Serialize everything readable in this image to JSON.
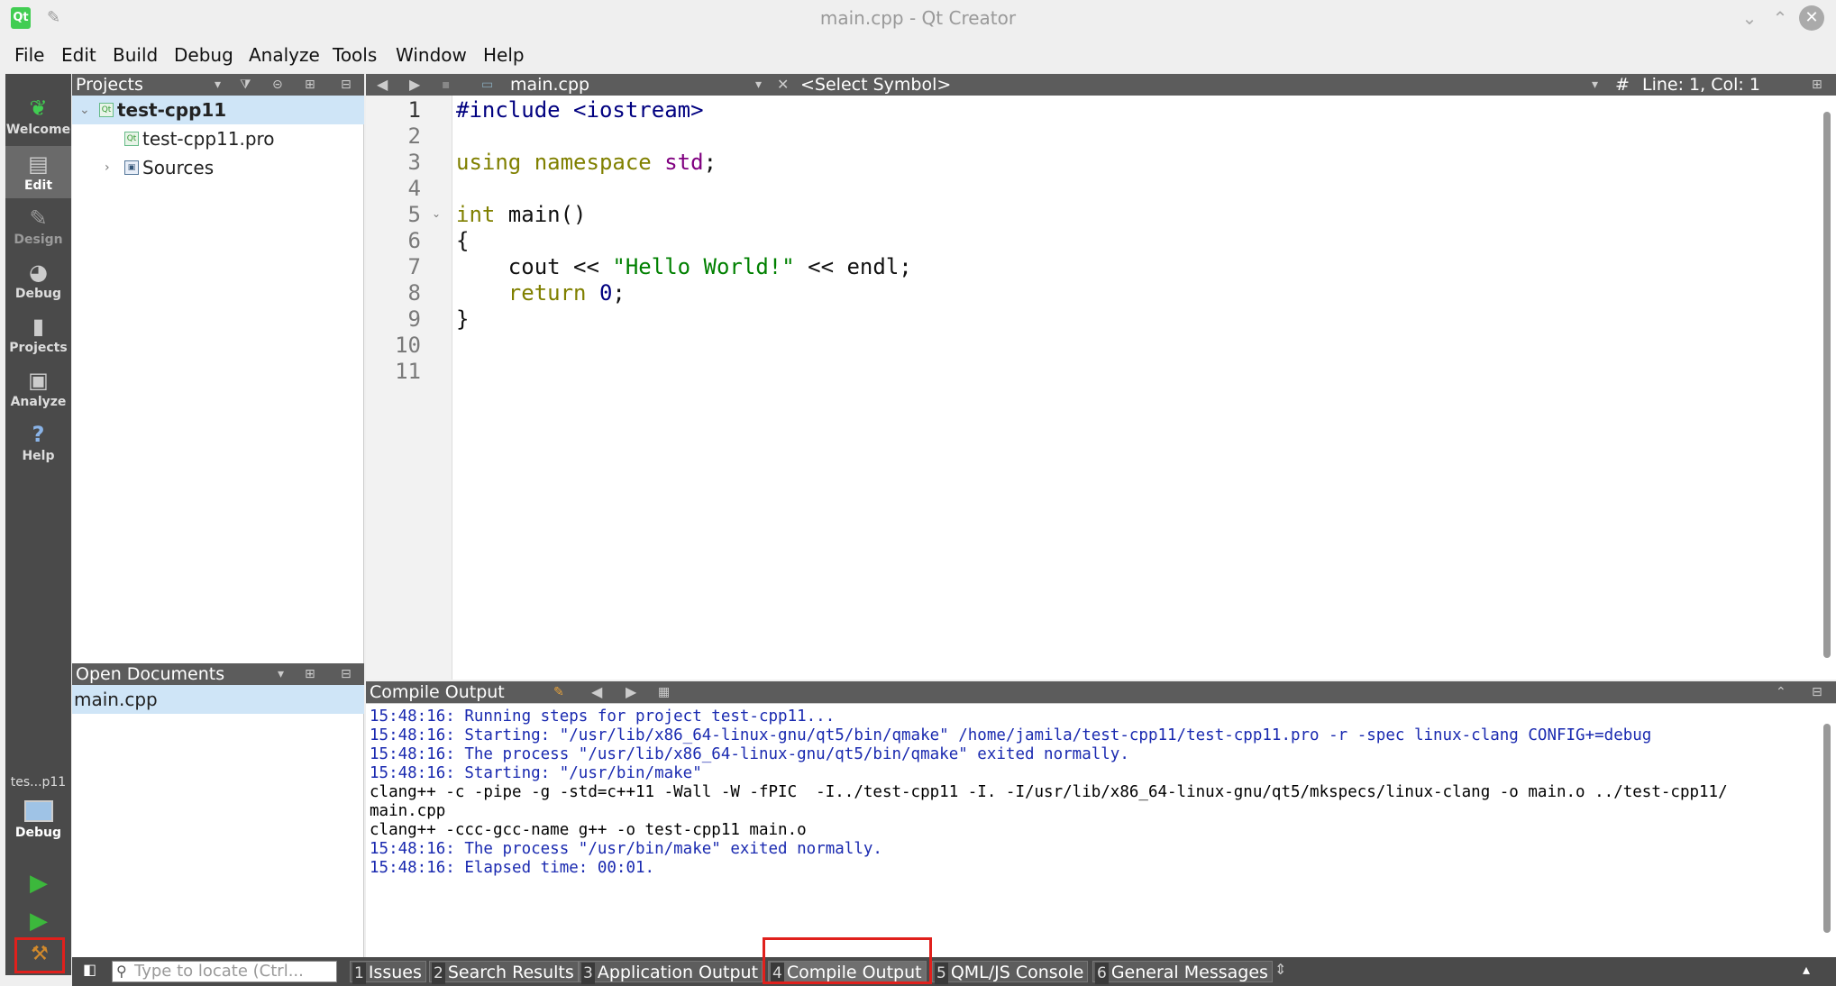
{
  "window": {
    "title": "main.cpp - Qt Creator",
    "logo_text": "Qt"
  },
  "menu": [
    "File",
    "Edit",
    "Build",
    "Debug",
    "Analyze",
    "Tools",
    "Window",
    "Help"
  ],
  "modes": [
    {
      "label": "Welcome",
      "icon": "qt-leaf-icon"
    },
    {
      "label": "Edit",
      "icon": "document-icon"
    },
    {
      "label": "Design",
      "icon": "pen-icon"
    },
    {
      "label": "Debug",
      "icon": "bug-icon"
    },
    {
      "label": "Projects",
      "icon": "wrench-icon"
    },
    {
      "label": "Analyze",
      "icon": "monitor-icon"
    },
    {
      "label": "Help",
      "icon": "question-icon"
    }
  ],
  "kit": {
    "project_short": "tes...p11",
    "build_config": "Debug"
  },
  "projects_panel": {
    "title": "Projects",
    "tree": [
      {
        "label": "test-cpp11",
        "level": 0,
        "expanded": true,
        "selected": true
      },
      {
        "label": "test-cpp11.pro",
        "level": 1
      },
      {
        "label": "Sources",
        "level": 1,
        "expanded": false
      }
    ]
  },
  "open_documents": {
    "title": "Open Documents",
    "items": [
      "main.cpp"
    ]
  },
  "editor": {
    "file_name": "main.cpp",
    "symbol_placeholder": "<Select Symbol>",
    "position": "Line: 1, Col: 1",
    "hash": "#",
    "line_numbers": [
      "1",
      "2",
      "3",
      "4",
      "5",
      "6",
      "7",
      "8",
      "9",
      "10",
      "11"
    ],
    "code": {
      "l1_directive": "#include",
      "l1_header": "<iostream>",
      "l3_using": "using",
      "l3_namespace": "namespace",
      "l3_std": "std",
      "l3_semicolon": ";",
      "l5_int": "int",
      "l5_rest": " main()",
      "l6": "{",
      "l7_cout": "    cout << ",
      "l7_string": "\"Hello World!\"",
      "l7_rest": " << endl;",
      "l8_return": "    return",
      "l8_space": " ",
      "l8_zero": "0",
      "l8_semicolon": ";",
      "l9": "}"
    }
  },
  "output_panel": {
    "title": "Compile Output",
    "lines": [
      {
        "text": "15:48:16: Running steps for project test-cpp11...",
        "style": "blue"
      },
      {
        "text": "15:48:16: Starting: \"/usr/lib/x86_64-linux-gnu/qt5/bin/qmake\" /home/jamila/test-cpp11/test-cpp11.pro -r -spec linux-clang CONFIG+=debug",
        "style": "blue"
      },
      {
        "text": "15:48:16: The process \"/usr/lib/x86_64-linux-gnu/qt5/bin/qmake\" exited normally.",
        "style": "blue"
      },
      {
        "text": "15:48:16: Starting: \"/usr/bin/make\"",
        "style": "blue"
      },
      {
        "text": "clang++ -c -pipe -g -std=c++11 -Wall -W -fPIC  -I../test-cpp11 -I. -I/usr/lib/x86_64-linux-gnu/qt5/mkspecs/linux-clang -o main.o ../test-cpp11/",
        "style": "black"
      },
      {
        "text": "main.cpp",
        "style": "black"
      },
      {
        "text": "clang++ -ccc-gcc-name g++ -o test-cpp11 main.o",
        "style": "black"
      },
      {
        "text": "15:48:16: The process \"/usr/bin/make\" exited normally.",
        "style": "blue"
      },
      {
        "text": "15:48:16: Elapsed time: 00:01.",
        "style": "blue"
      }
    ]
  },
  "statusbar": {
    "locator_placeholder": "Type to locate (Ctrl...",
    "tabs": [
      {
        "num": "1",
        "label": "Issues"
      },
      {
        "num": "2",
        "label": "Search Results"
      },
      {
        "num": "3",
        "label": "Application Output"
      },
      {
        "num": "4",
        "label": "Compile Output",
        "active": true
      },
      {
        "num": "5",
        "label": "QML/JS Console"
      },
      {
        "num": "6",
        "label": "General Messages"
      }
    ]
  },
  "colors": {
    "keyword": "#808000",
    "preprocessor": "#000080",
    "string": "#008000",
    "namespace": "#800080",
    "highlight_box": "#e0201c",
    "selection": "#cfe5f7"
  }
}
